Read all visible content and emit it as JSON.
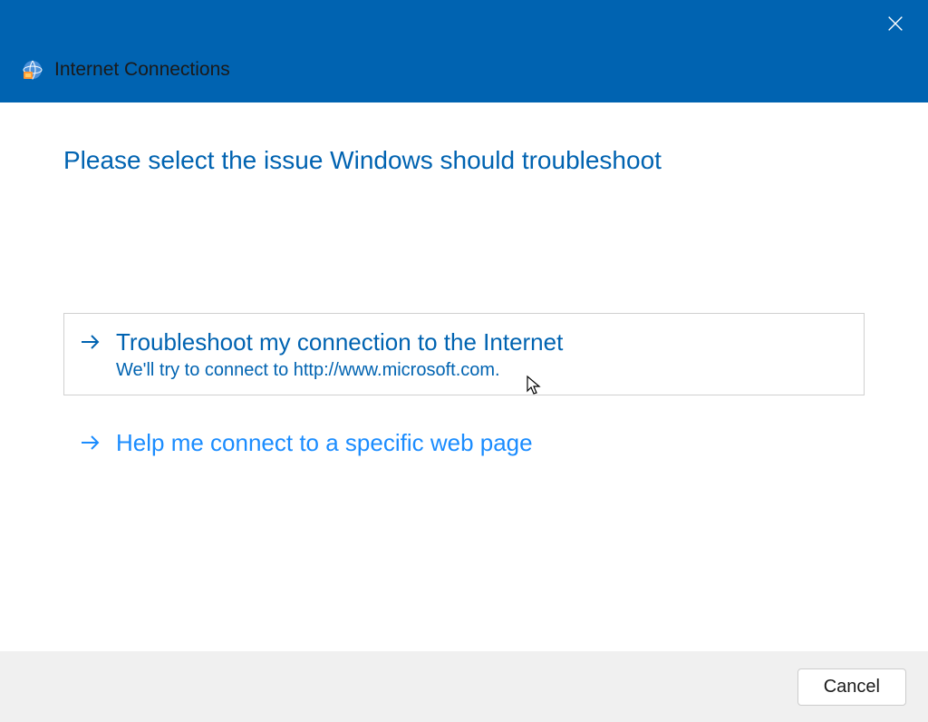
{
  "titlebar": {
    "title": "Internet Connections"
  },
  "content": {
    "heading": "Please select the issue Windows should troubleshoot",
    "options": [
      {
        "title": "Troubleshoot my connection to the Internet",
        "subtitle": "We'll try to connect to http://www.microsoft.com."
      },
      {
        "title": "Help me connect to a specific web page"
      }
    ]
  },
  "footer": {
    "cancel_label": "Cancel"
  }
}
